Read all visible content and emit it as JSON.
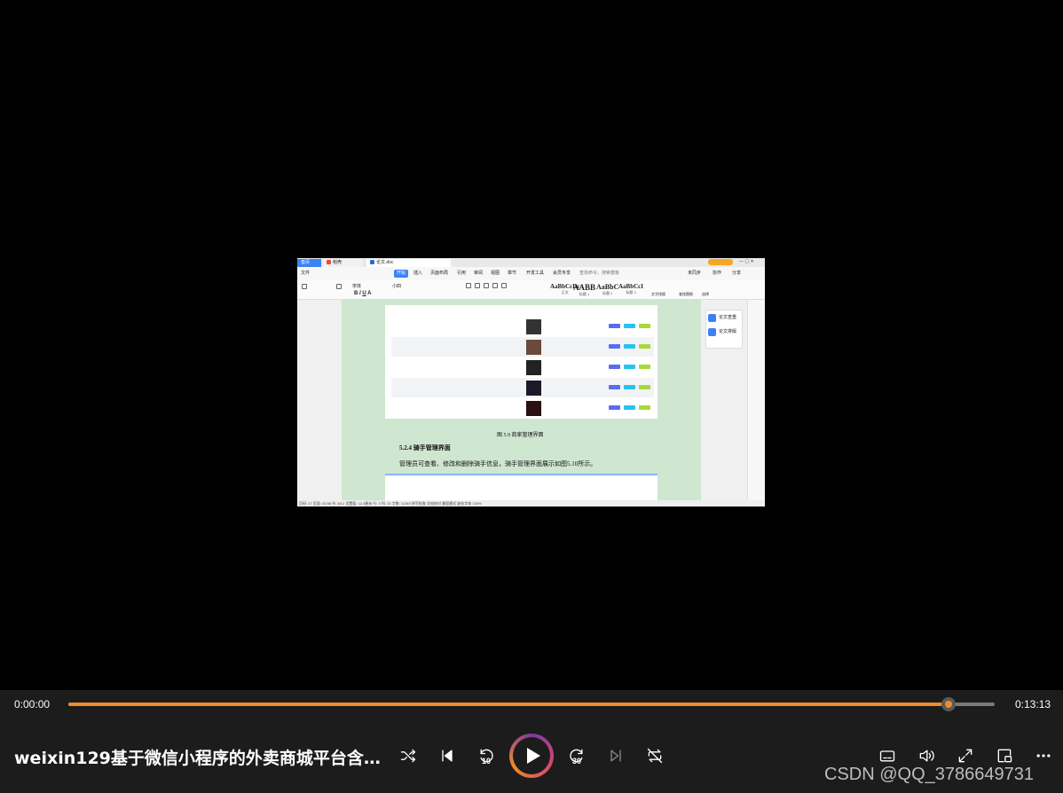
{
  "player": {
    "current_time": "0:00:00",
    "duration": "0:13:13",
    "progress_fraction": 0.95,
    "title": "weixin129基于微信小程序的外卖商城平台含...",
    "watermark": "CSDN @QQ_3786649731",
    "rewind_seconds": "10",
    "forward_seconds": "30",
    "accent_color": "#f08a2c",
    "controls": [
      "shuffle-icon",
      "previous-icon",
      "rewind-10-icon",
      "play-icon",
      "forward-30-icon",
      "next-icon",
      "repeat-off-icon",
      "subtitles-icon",
      "volume-icon",
      "fullscreen-icon",
      "mini-player-icon",
      "more-icon"
    ]
  },
  "video_frame": {
    "tabs": {
      "home": "首页",
      "tab1": "稻壳",
      "tab2": "论文.doc"
    },
    "menu": [
      "文件",
      "开始",
      "插入",
      "页面布局",
      "引用",
      "审阅",
      "视图",
      "章节",
      "开发工具",
      "会员专享"
    ],
    "menu_active": "开始",
    "search_placeholder": "查找命令、搜索模板",
    "top_right": [
      "未同步",
      "协作",
      "分享"
    ],
    "styles": [
      {
        "sample": "AaBbCcDc",
        "name": "正文"
      },
      {
        "sample": "AABB",
        "name": "标题 1"
      },
      {
        "sample": "AaBbC",
        "name": "标题 2"
      },
      {
        "sample": "AaBbCcI",
        "name": "标题 3"
      }
    ],
    "ribbon_right": [
      "文字排版",
      "查找替换",
      "选择"
    ],
    "font_name": "宋体",
    "font_size": "小四",
    "doc": {
      "figure_caption": "图 5.9   商家管理界面",
      "heading": "5.2.4 骑手管理界面",
      "paragraph": "管理员可查看、修改和删除骑手信息，骑手管理界面展示如图5.10所示。"
    },
    "side_panel": [
      "论文查重",
      "论文排版"
    ],
    "status_bar": "页码: 27   页面: 32/38   节: 8/12   设置值: 12.4厘米   行: 3   列: 10   字数: 11345   拼写检查   文档校对   兼容模式   缺失字体      130%"
  }
}
